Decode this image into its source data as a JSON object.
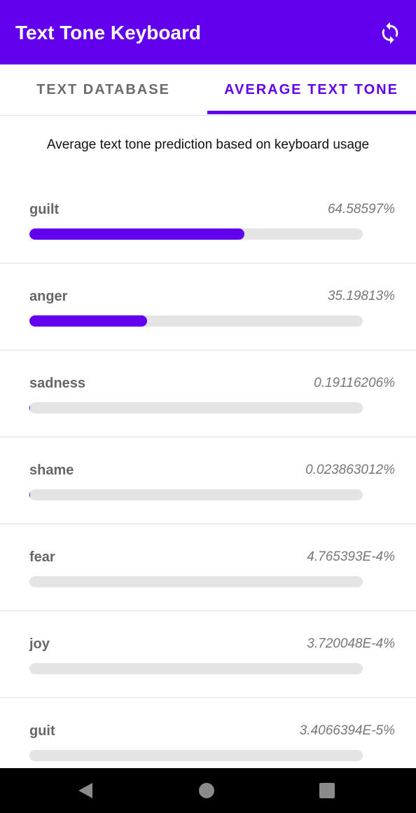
{
  "appbar": {
    "title": "Text Tone Keyboard",
    "refresh_icon": "refresh-icon",
    "background_color": "#6200ee"
  },
  "tabs": [
    {
      "label": "TEXT DATABASE",
      "selected": false
    },
    {
      "label": "AVERAGE TEXT TONE",
      "selected": true
    }
  ],
  "subtitle": "Average text tone prediction based on keyboard usage",
  "accent_color": "#6200ee",
  "tones": [
    {
      "label": "guilt",
      "value": "64.58597%",
      "percent": 64.58597
    },
    {
      "label": "anger",
      "value": "35.19813%",
      "percent": 35.19813
    },
    {
      "label": "sadness",
      "value": "0.19116206%",
      "percent": 0.19116206
    },
    {
      "label": "shame",
      "value": "0.023863012%",
      "percent": 0.023863012
    },
    {
      "label": "fear",
      "value": "4.765393E-4%",
      "percent": 0.0004765393
    },
    {
      "label": "joy",
      "value": "3.720048E-4%",
      "percent": 0.0003720048
    },
    {
      "label": "guit",
      "value": "3.4066394E-5%",
      "percent": 3.4066394e-05
    }
  ],
  "navbar": {
    "back_icon": "back-triangle-icon",
    "home_icon": "home-circle-icon",
    "recents_icon": "recents-square-icon"
  }
}
